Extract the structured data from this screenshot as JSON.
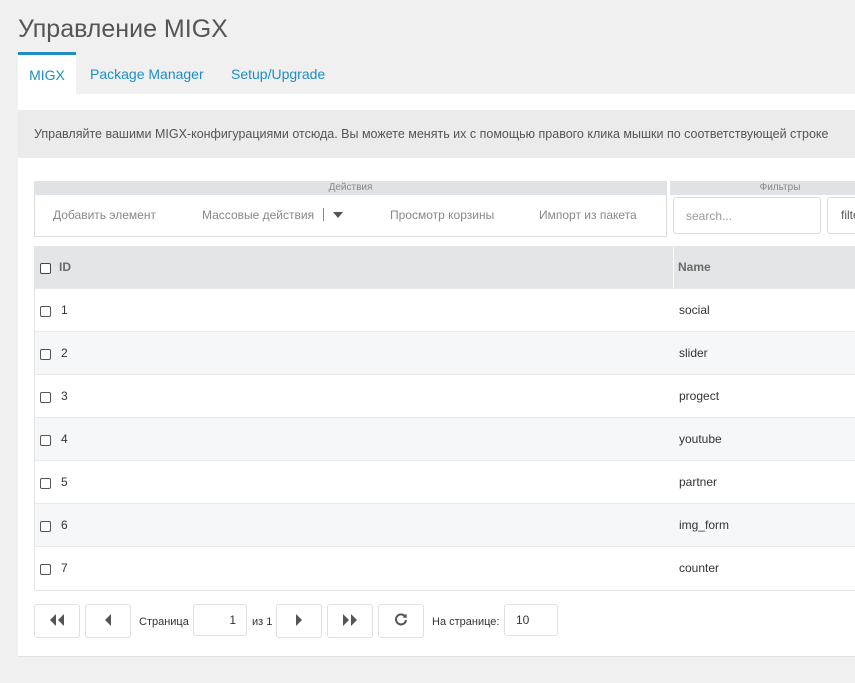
{
  "page": {
    "title": "Управление MIGX"
  },
  "tabs": [
    {
      "label": "MIGX"
    },
    {
      "label": "Package Manager"
    },
    {
      "label": "Setup/Upgrade"
    }
  ],
  "info_text": "Управляйте вашими MIGX-конфигурациями отсюда. Вы можете менять их с помощью правого клика мышки по соответствующей строке",
  "toolbar": {
    "actions_title": "Действия",
    "filters_title": "Фильтры",
    "add_item": "Добавить элемент",
    "bulk_actions": "Массовые действия",
    "view_trash": "Просмотр корзины",
    "import_package": "Импорт из пакета",
    "search_placeholder": "search...",
    "filter_value": "filter"
  },
  "grid": {
    "columns": [
      "ID",
      "Name"
    ],
    "rows": [
      {
        "id": "1",
        "name": "social"
      },
      {
        "id": "2",
        "name": "slider"
      },
      {
        "id": "3",
        "name": "progect"
      },
      {
        "id": "4",
        "name": "youtube"
      },
      {
        "id": "5",
        "name": "partner"
      },
      {
        "id": "6",
        "name": "img_form"
      },
      {
        "id": "7",
        "name": "counter"
      }
    ]
  },
  "pager": {
    "page_label": "Страница",
    "page_value": "1",
    "of_label": "из 1",
    "per_page_label": "На странице:",
    "per_page_value": "10"
  },
  "icons": {
    "first": "double-chevron-left-icon",
    "prev": "triangle-left-icon",
    "next": "triangle-right-icon",
    "last": "double-chevron-right-icon",
    "refresh": "refresh-icon",
    "dropdown": "caret-down-icon"
  },
  "colors": {
    "accent": "#1e8ec2",
    "background": "#f0f0f0",
    "header": "#e3e6e8"
  }
}
